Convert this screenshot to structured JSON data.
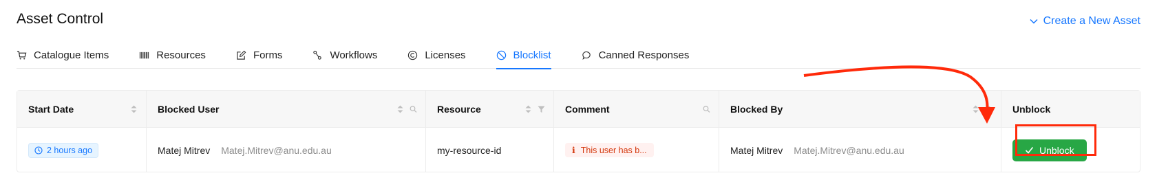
{
  "header": {
    "title": "Asset Control",
    "create_label": "Create a New Asset"
  },
  "tabs": [
    {
      "label": "Catalogue Items",
      "icon": "cart-icon"
    },
    {
      "label": "Resources",
      "icon": "barcode-icon"
    },
    {
      "label": "Forms",
      "icon": "edit-icon"
    },
    {
      "label": "Workflows",
      "icon": "workflow-icon"
    },
    {
      "label": "Licenses",
      "icon": "copyright-icon"
    },
    {
      "label": "Blocklist",
      "icon": "block-icon",
      "active": true
    },
    {
      "label": "Canned Responses",
      "icon": "chat-icon"
    }
  ],
  "table": {
    "columns": [
      "Start Date",
      "Blocked User",
      "Resource",
      "Comment",
      "Blocked By",
      "Unblock"
    ],
    "rows": [
      {
        "start_date": "2 hours ago",
        "blocked_user_name": "Matej Mitrev",
        "blocked_user_email": "Matej.Mitrev@anu.edu.au",
        "resource": "my-resource-id",
        "comment": "This user has b...",
        "blocked_by_name": "Matej Mitrev",
        "blocked_by_email": "Matej.Mitrev@anu.edu.au",
        "action_label": "Unblock"
      }
    ]
  },
  "colors": {
    "accent": "#1677ff",
    "success": "#28a745",
    "annotation": "#ff2a0a",
    "error_text": "#d4380d"
  }
}
